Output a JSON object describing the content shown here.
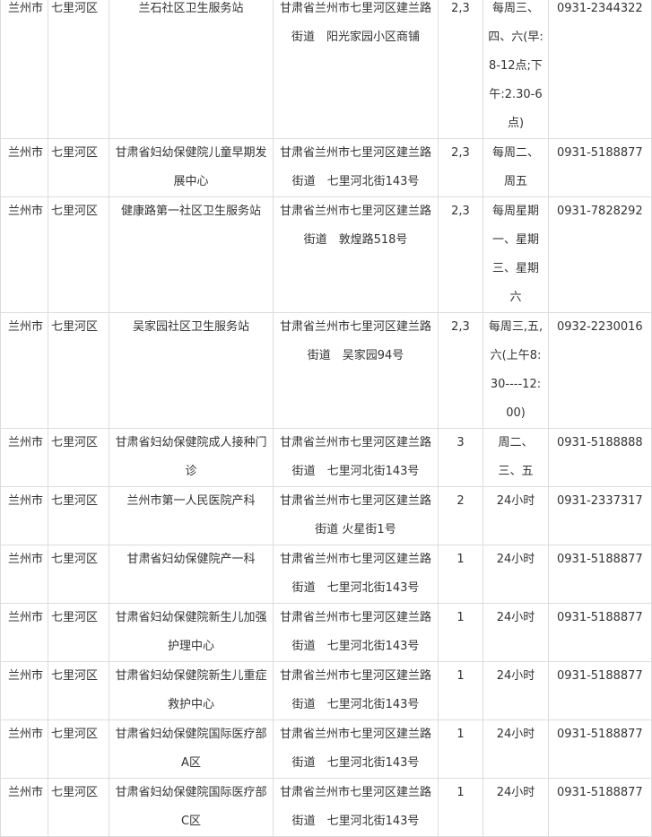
{
  "rows": [
    {
      "city": "兰州市",
      "district": "七里河区",
      "name": "兰石社区卫生服务站",
      "address": "甘肃省兰州市七里河区建兰路街道　阳光家园小区商铺",
      "level": "2,3",
      "time": "每周三、四、六(早:8-12点;下午:2.30-6点)",
      "phone": "0931-2344322"
    },
    {
      "city": "兰州市",
      "district": "七里河区",
      "name": "甘肃省妇幼保健院儿童早期发展中心",
      "address": "甘肃省兰州市七里河区建兰路街道　七里河北街143号",
      "level": "2,3",
      "time": "每周二、周五",
      "phone": "0931-5188877"
    },
    {
      "city": "兰州市",
      "district": "七里河区",
      "name": "健康路第一社区卫生服务站",
      "address": "甘肃省兰州市七里河区建兰路街道　敦煌路518号",
      "level": "2,3",
      "time": "每周星期一、星期三、星期六",
      "phone": "0931-7828292"
    },
    {
      "city": "兰州市",
      "district": "七里河区",
      "name": "吴家园社区卫生服务站",
      "address": "甘肃省兰州市七里河区建兰路街道　吴家园94号",
      "level": "2,3",
      "time": "每周三,五,六(上午8:30----12:00)",
      "phone": "0932-2230016"
    },
    {
      "city": "兰州市",
      "district": "七里河区",
      "name": "甘肃省妇幼保健院成人接种门诊",
      "address": "甘肃省兰州市七里河区建兰路街道　七里河北街143号",
      "level": "3",
      "time": "周二、三、五",
      "phone": "0931-5188888"
    },
    {
      "city": "兰州市",
      "district": "七里河区",
      "name": "兰州市第一人民医院产科",
      "address": "甘肃省兰州市七里河区建兰路街道 火星街1号",
      "level": "2",
      "time": "24小时",
      "phone": "0931-2337317"
    },
    {
      "city": "兰州市",
      "district": "七里河区",
      "name": "甘肃省妇幼保健院产一科",
      "address": "甘肃省兰州市七里河区建兰路街道　七里河北街143号",
      "level": "1",
      "time": "24小时",
      "phone": "0931-5188877"
    },
    {
      "city": "兰州市",
      "district": "七里河区",
      "name": "甘肃省妇幼保健院新生儿加强护理中心",
      "address": "甘肃省兰州市七里河区建兰路街道　七里河北街143号",
      "level": "1",
      "time": "24小时",
      "phone": "0931-5188877"
    },
    {
      "city": "兰州市",
      "district": "七里河区",
      "name": "甘肃省妇幼保健院新生儿重症救护中心",
      "address": "甘肃省兰州市七里河区建兰路街道　七里河北街143号",
      "level": "1",
      "time": "24小时",
      "phone": "0931-5188877"
    },
    {
      "city": "兰州市",
      "district": "七里河区",
      "name": "甘肃省妇幼保健院国际医疗部A区",
      "address": "甘肃省兰州市七里河区建兰路街道　七里河北街143号",
      "level": "1",
      "time": "24小时",
      "phone": "0931-5188877"
    },
    {
      "city": "兰州市",
      "district": "七里河区",
      "name": "甘肃省妇幼保健院国际医疗部C区",
      "address": "甘肃省兰州市七里河区建兰路街道　七里河北街143号",
      "level": "1",
      "time": "24小时",
      "phone": "0931-5188877"
    }
  ]
}
